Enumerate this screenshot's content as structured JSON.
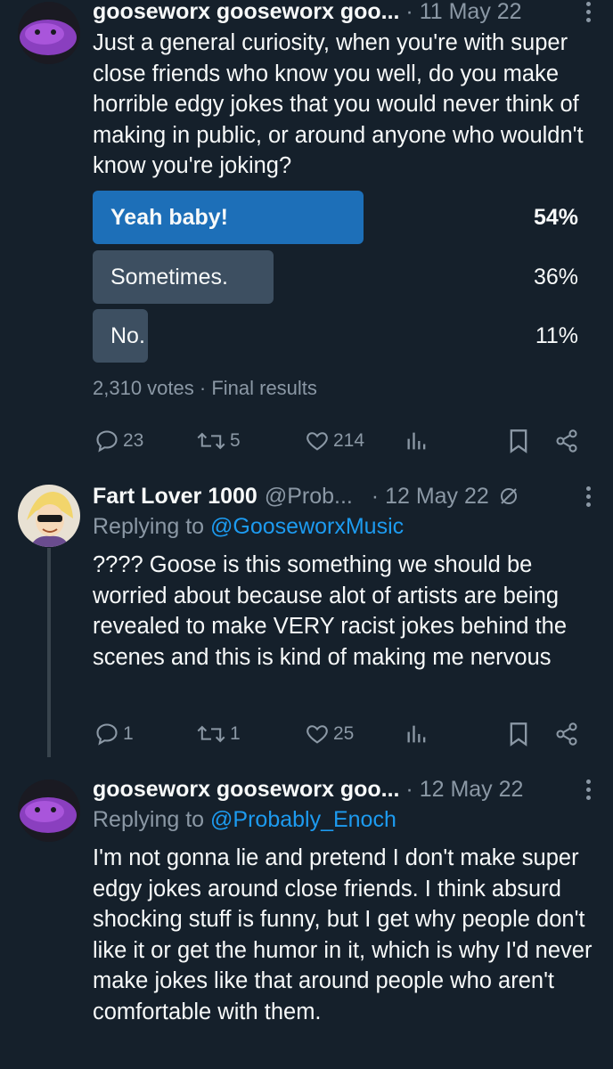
{
  "tweets": [
    {
      "name": "gooseworx gooseworx goo...",
      "handle": "",
      "date": "11 May 22",
      "text": "Just a general curiosity, when you're with super close friends who know you well, do you make horrible edgy jokes that you would never think of making in public, or around anyone who wouldn't know you're joking?",
      "avatar": "purple-blob-avatar",
      "poll": {
        "options": [
          {
            "label": "Yeah baby!",
            "percent": 54,
            "winner": true
          },
          {
            "label": "Sometimes.",
            "percent": 36,
            "winner": false
          },
          {
            "label": "No.",
            "percent": 11,
            "winner": false
          }
        ],
        "votes": "2,310 votes",
        "status": "Final results"
      },
      "actions": {
        "replies": "23",
        "retweets": "5",
        "likes": "214"
      }
    },
    {
      "name": "Fart Lover 1000",
      "handle": "@Prob...",
      "date": "12 May 22",
      "replying_prefix": "Replying to",
      "replying_to": "@GooseworxMusic",
      "text": "???? Goose is this something we should be worried about because alot of artists are being revealed to make VERY racist jokes behind the scenes and this is kind of making me nervous",
      "avatar": "cartoon-sunglasses-avatar",
      "actions": {
        "replies": "1",
        "retweets": "1",
        "likes": "25"
      }
    },
    {
      "name": "gooseworx gooseworx goo...",
      "date": "12 May 22",
      "replying_prefix": "Replying to",
      "replying_to": "@Probably_Enoch",
      "text": "I'm not gonna lie and pretend I don't make super edgy jokes around close friends. I think absurd shocking stuff is funny, but I get why people don't like it or get the humor in it, which is why I'd never make jokes like that around people who aren't comfortable with them.",
      "avatar": "purple-blob-avatar"
    }
  ],
  "colors": {
    "background": "#15202b",
    "text": "#f7f9f9",
    "muted": "#8b98a5",
    "link": "#1d9bf0",
    "poll_winner": "#1d6fb8",
    "poll_other": "#3d4f61"
  }
}
